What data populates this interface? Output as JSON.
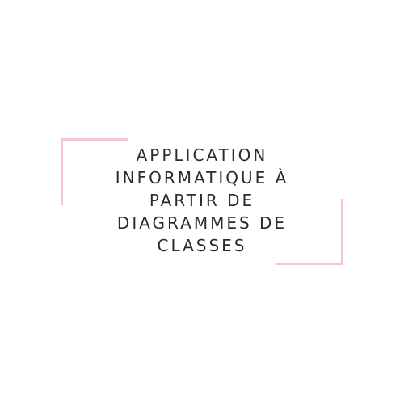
{
  "accent_color": "#f6c5d0",
  "text_color": "#2b2b2b",
  "title_lines": [
    "APPLICATION",
    "INFORMATIQUE À",
    "PARTIR DE",
    "DIAGRAMMES DE",
    "CLASSES"
  ]
}
